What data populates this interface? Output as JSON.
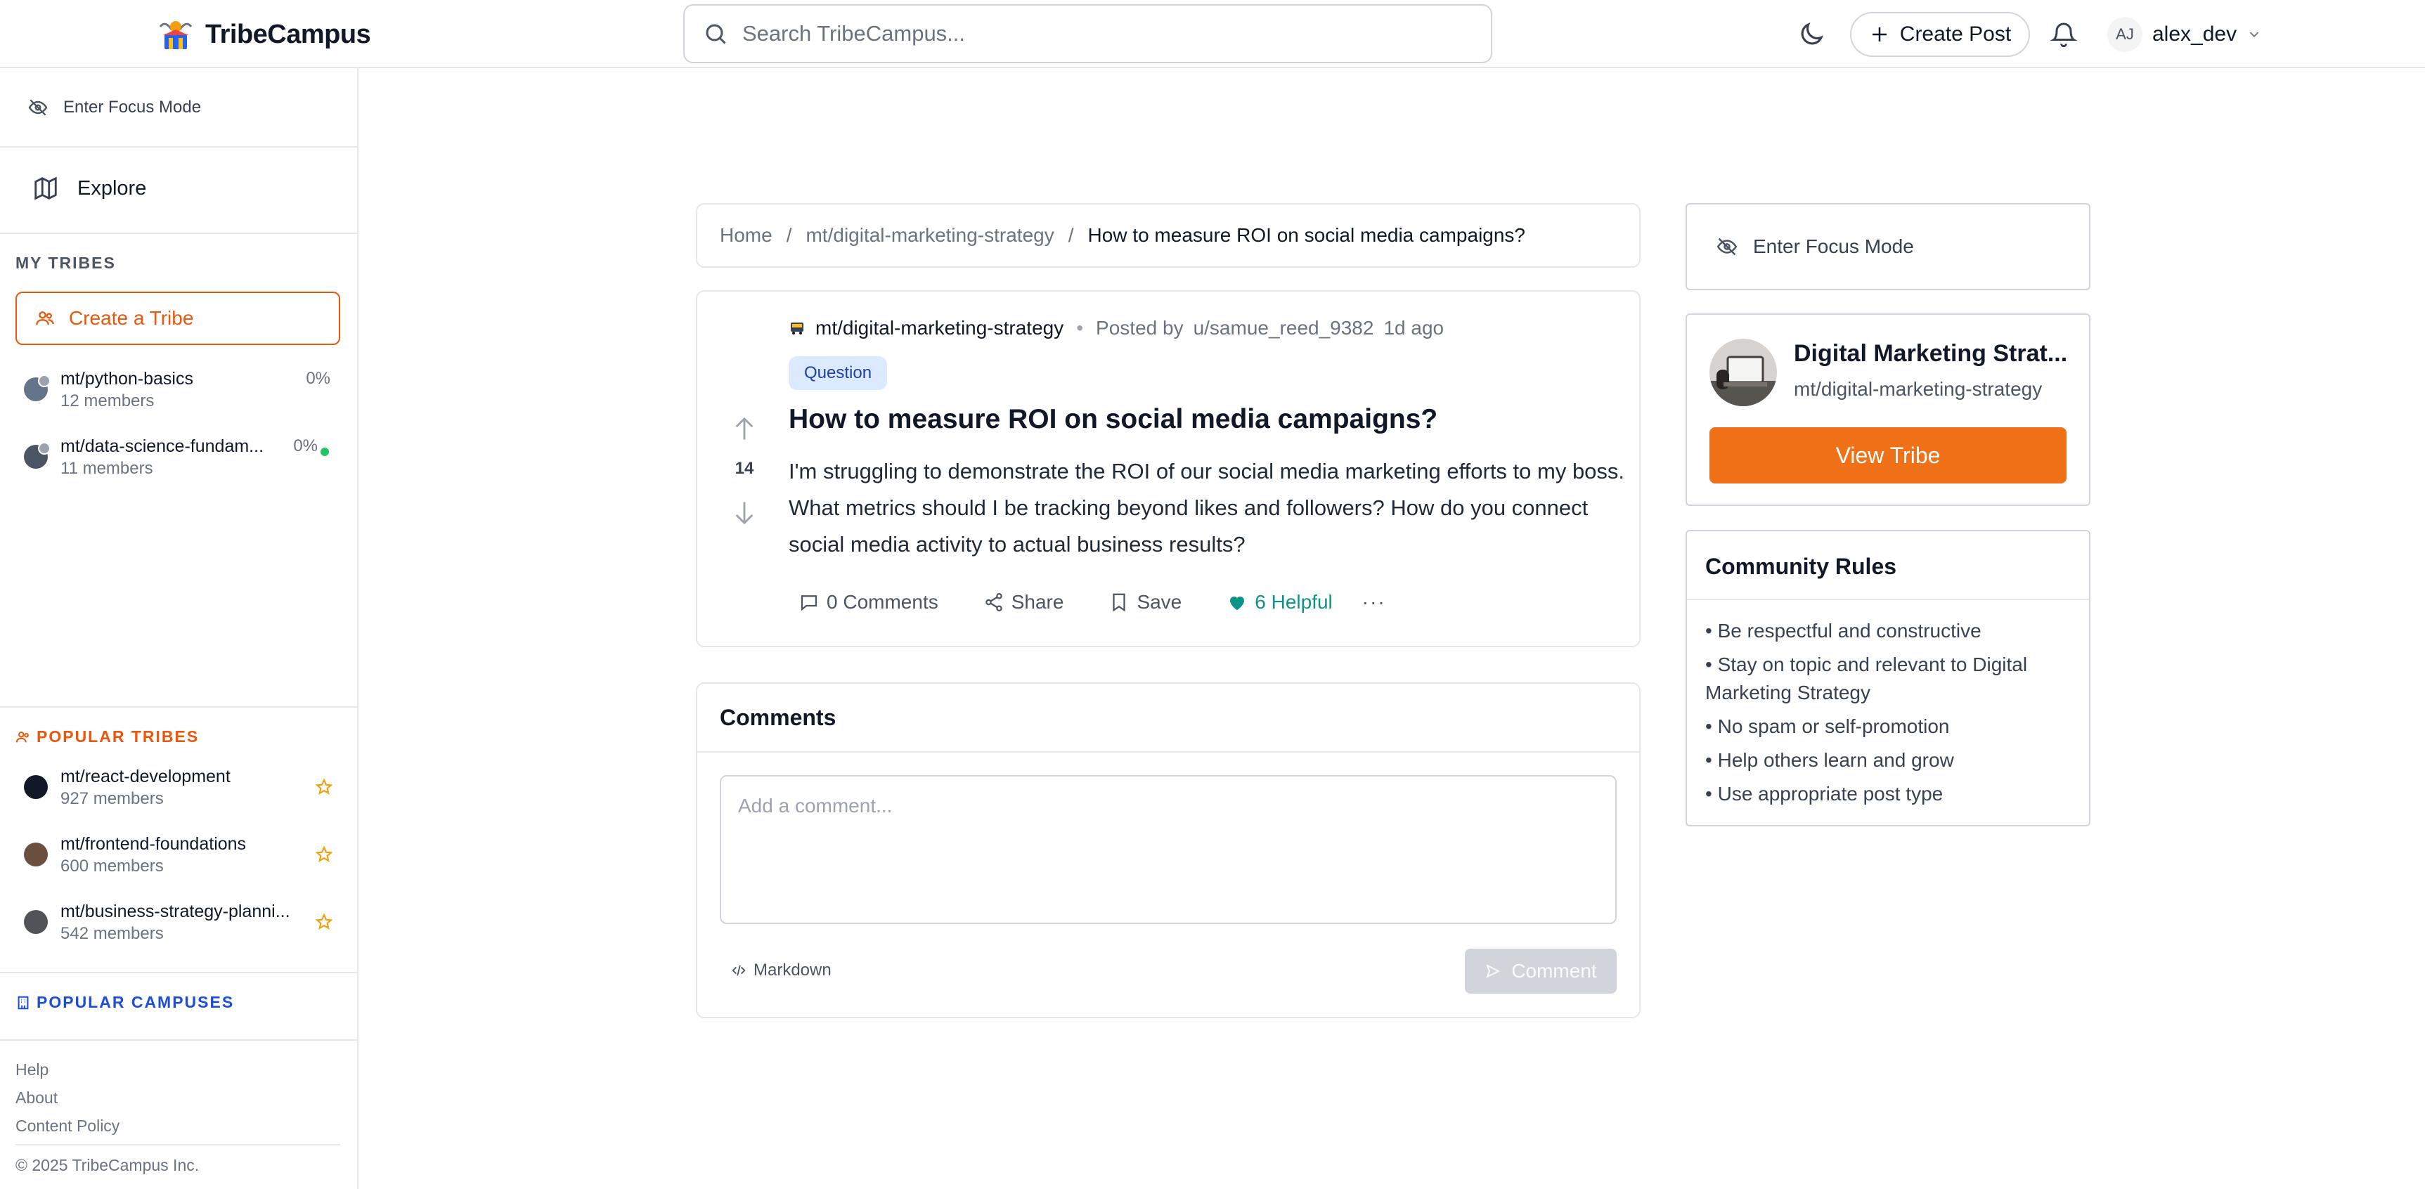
{
  "header": {
    "brand": "TribeCampus",
    "search_placeholder": "Search TribeCampus...",
    "create_post_label": "Create Post",
    "user_initials": "AJ",
    "username": "alex_dev"
  },
  "sidebar": {
    "focus_mode_label": "Enter Focus Mode",
    "explore_label": "Explore",
    "my_tribes_heading": "MY TRIBES",
    "create_tribe_label": "Create a Tribe",
    "my_tribes": [
      {
        "name": "mt/python-basics",
        "members": "12 members",
        "progress": "0%"
      },
      {
        "name": "mt/data-science-fundam...",
        "members": "11 members",
        "progress": "0%"
      }
    ],
    "popular_tribes_heading": "POPULAR TRIBES",
    "popular_tribes": [
      {
        "name": "mt/react-development",
        "members": "927 members"
      },
      {
        "name": "mt/frontend-foundations",
        "members": "600 members"
      },
      {
        "name": "mt/business-strategy-planni...",
        "members": "542 members"
      }
    ],
    "popular_campuses_heading": "POPULAR CAMPUSES",
    "footer_links": [
      "Help",
      "About",
      "Content Policy"
    ],
    "copyright": "© 2025 TribeCampus Inc."
  },
  "breadcrumb": {
    "home": "Home",
    "sep": "/",
    "tribe": "mt/digital-marketing-strategy",
    "current": "How to measure ROI on social media campaigns?"
  },
  "post": {
    "tribe": "mt/digital-marketing-strategy",
    "meta_dot": "•",
    "posted_by_label": "Posted by",
    "author": "u/samue_reed_9382",
    "time": "1d ago",
    "tag": "Question",
    "votes": "14",
    "title": "How to measure ROI on social media campaigns?",
    "body": "I'm struggling to demonstrate the ROI of our social media marketing efforts to my boss. What metrics should I be tracking beyond likes and followers? How do you connect social media activity to actual business results?",
    "comments_label": "0 Comments",
    "share_label": "Share",
    "save_label": "Save",
    "helpful_label": "6 Helpful",
    "more_label": "···"
  },
  "comments": {
    "title": "Comments",
    "placeholder": "Add a comment...",
    "markdown_label": "Markdown",
    "submit_label": "Comment"
  },
  "right": {
    "focus_mode_label": "Enter Focus Mode",
    "tribe_name": "Digital Marketing Strat...",
    "tribe_slug": "mt/digital-marketing-strategy",
    "view_tribe_label": "View Tribe",
    "rules_title": "Community Rules",
    "rules": [
      "Be respectful and constructive",
      "Stay on topic and relevant to Digital Marketing Strategy",
      "No spam or self-promotion",
      "Help others learn and grow",
      "Use appropriate post type"
    ]
  },
  "colors": {
    "accent_orange": "#f07118",
    "accent_blue": "#1d4ed8",
    "helpful_teal": "#0d9488"
  }
}
